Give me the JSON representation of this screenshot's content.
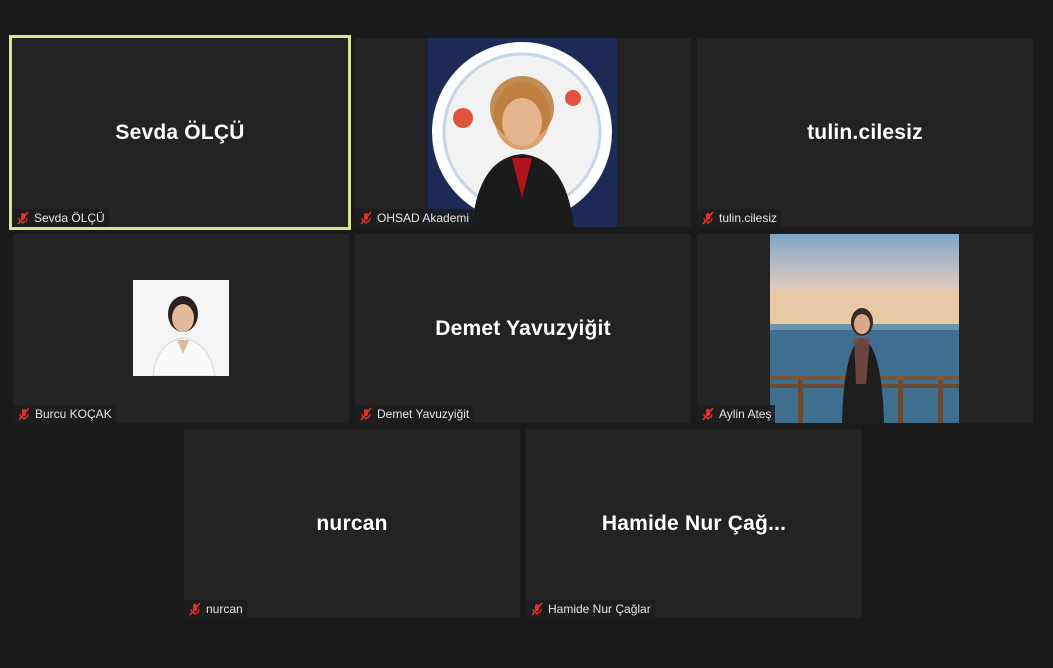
{
  "participants": [
    {
      "id": "sevda",
      "display_name": "Sevda ÖLÇÜ",
      "label": "Sevda ÖLÇÜ",
      "active": true,
      "muted": true
    },
    {
      "id": "ohsad",
      "display_name": "",
      "label": "OHSAD Akademi",
      "muted": true,
      "photo": "logo-portrait"
    },
    {
      "id": "tulin",
      "display_name": "tulin.cilesiz",
      "label": "tulin.cilesiz",
      "muted": true
    },
    {
      "id": "burcu",
      "display_name": "",
      "label": "Burcu KOÇAK",
      "muted": true,
      "photo": "small-portrait"
    },
    {
      "id": "demet",
      "display_name": "Demet Yavuzyiğit",
      "label": "Demet Yavuzyiğit",
      "muted": true
    },
    {
      "id": "aylin",
      "display_name": "",
      "label": "Aylin Ateş",
      "muted": true,
      "photo": "seaside-portrait"
    },
    {
      "id": "nurcan",
      "display_name": "nurcan",
      "label": "nurcan",
      "muted": true
    },
    {
      "id": "hamide",
      "display_name": "Hamide Nur Çağ...",
      "label": "Hamide Nur Çağlar",
      "muted": true
    }
  ],
  "colors": {
    "background": "#1a1a1a",
    "tile": "#232323",
    "active_border": "#d4e78a",
    "mic_muted": "#e0312e"
  },
  "icons": {
    "muted": "mic-muted-icon"
  }
}
